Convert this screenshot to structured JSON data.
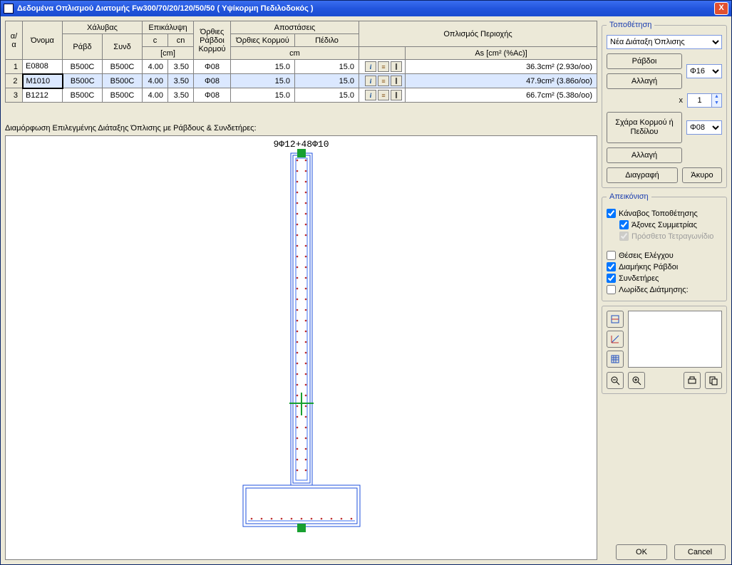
{
  "window": {
    "title": "Δεδομένα Οπλισμού Διατομής Fw300/70/20/120/50/50 ( Υψίκορμη Πεδιλοδοκός )"
  },
  "table": {
    "headers": {
      "aa": "α/α",
      "name": "Όνομα",
      "steel": "Χάλυβας",
      "rod": "Ράβδ",
      "tie": "Συνδ",
      "cover": "Επικάλυψη",
      "c": "c",
      "cn": "cn",
      "cm": "[cm]",
      "vert_bars": "Όρθιες Ράβδοι Κορμού",
      "distances": "Αποστάσεις",
      "dist_web": "Όρθιες Κορμού",
      "dist_foot": "Πέδιλο",
      "dist_unit": "cm",
      "region_reinf": "Οπλισμός Περιοχής",
      "as_unit": "As [cm² (%Ac)]"
    },
    "rows": [
      {
        "n": "1",
        "name": "E0808",
        "rod": "B500C",
        "tie": "B500C",
        "c": "4.00",
        "cn": "3.50",
        "vb": "Φ08",
        "dw": "15.0",
        "df": "15.0",
        "as": "36.3cm² (2.93o/oo)"
      },
      {
        "n": "2",
        "name": "M1010",
        "rod": "B500C",
        "tie": "B500C",
        "c": "4.00",
        "cn": "3.50",
        "vb": "Φ08",
        "dw": "15.0",
        "df": "15.0",
        "as": "47.9cm² (3.86o/oo)",
        "selected": true
      },
      {
        "n": "3",
        "name": "B1212",
        "rod": "B500C",
        "tie": "B500C",
        "c": "4.00",
        "cn": "3.50",
        "vb": "Φ08",
        "dw": "15.0",
        "df": "15.0",
        "as": "66.7cm² (5.38o/oo)"
      }
    ]
  },
  "section_label": "Διαμόρφωση Επιλεγμένης Διάταξης Όπλισης με Ράβδους & Συνδετήρες:",
  "drawing": {
    "label": "9Φ12+48Φ10"
  },
  "panel": {
    "placement": {
      "legend": "Τοποθέτηση",
      "combo": "Νέα Διάταξη Όπλισης",
      "bars_btn": "Ράβδοι",
      "change_btn": "Αλλαγή",
      "diam1": "Φ16",
      "x_label": "x",
      "x_value": "1",
      "grid_btn": "Σχάρα Κορμού ή Πεδίλου",
      "diam2": "Φ08",
      "change2_btn": "Αλλαγή",
      "delete_btn": "Διαγραφή",
      "cancel_btn": "Άκυρο"
    },
    "display": {
      "legend": "Απεικόνιση",
      "grid": "Κάναβος Τοποθέτησης",
      "sym": "Άξονες Συμμετρίας",
      "extra": "Πρόσθετο Τετραγωνίδιο",
      "check_pos": "Θέσεις Ελέγχου",
      "long_bars": "Διαμήκης Ράβδοι",
      "ties": "Συνδετήρες",
      "shear": "Λωρίδες Διάτμησης:"
    }
  },
  "footer": {
    "ok": "OK",
    "cancel": "Cancel"
  }
}
